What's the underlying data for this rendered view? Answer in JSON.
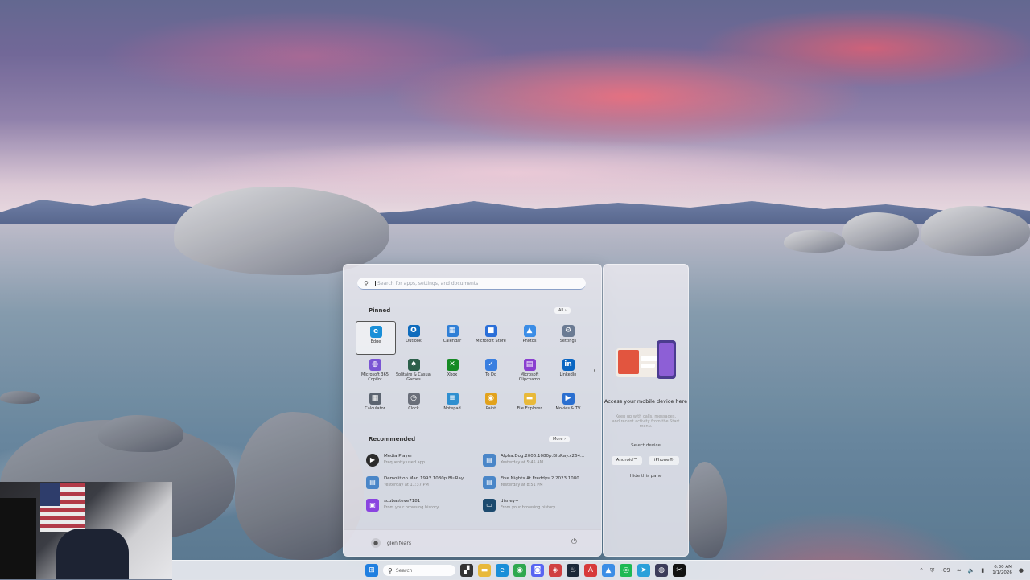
{
  "start_menu": {
    "search_placeholder": "Search for apps, settings, and documents",
    "pinned_title": "Pinned",
    "all_label": "All  ›",
    "pinned": [
      {
        "label": "Edge",
        "icon": "edge-icon",
        "color": "#1a8fd8",
        "glyph": "e"
      },
      {
        "label": "Outlook",
        "icon": "outlook-icon",
        "color": "#0f6cbd",
        "glyph": "O"
      },
      {
        "label": "Calendar",
        "icon": "calendar-icon",
        "color": "#2f7fd6",
        "glyph": "▦"
      },
      {
        "label": "Microsoft Store",
        "icon": "store-icon",
        "color": "#2b6fd8",
        "glyph": "■"
      },
      {
        "label": "Photos",
        "icon": "photos-icon",
        "color": "#3b8de6",
        "glyph": "▲"
      },
      {
        "label": "Settings",
        "icon": "gear-icon",
        "color": "#6b7b93",
        "glyph": "⚙"
      },
      {
        "label": "Microsoft 365 Copilot",
        "icon": "copilot-icon",
        "color": "#7a55d4",
        "glyph": "◍"
      },
      {
        "label": "Solitaire & Casual Games",
        "icon": "solitaire-icon",
        "color": "#2c5f4a",
        "glyph": "♠"
      },
      {
        "label": "Xbox",
        "icon": "xbox-icon",
        "color": "#168a24",
        "glyph": "✕"
      },
      {
        "label": "To Do",
        "icon": "todo-icon",
        "color": "#3a7fe0",
        "glyph": "✓"
      },
      {
        "label": "Microsoft Clipchamp",
        "icon": "clipchamp-icon",
        "color": "#8a3fd0",
        "glyph": "▤"
      },
      {
        "label": "LinkedIn",
        "icon": "linkedin-icon",
        "color": "#0a66c2",
        "glyph": "in"
      },
      {
        "label": "Calculator",
        "icon": "calculator-icon",
        "color": "#5c6470",
        "glyph": "▦"
      },
      {
        "label": "Clock",
        "icon": "clock-icon",
        "color": "#6a6f7a",
        "glyph": "◷"
      },
      {
        "label": "Notepad",
        "icon": "notepad-icon",
        "color": "#2e8fd0",
        "glyph": "≡"
      },
      {
        "label": "Paint",
        "icon": "paint-icon",
        "color": "#e2a21c",
        "glyph": "◉"
      },
      {
        "label": "File Explorer",
        "icon": "folder-icon",
        "color": "#e8b93a",
        "glyph": "▬"
      },
      {
        "label": "Movies & TV",
        "icon": "movies-icon",
        "color": "#2a6fd0",
        "glyph": "▶"
      }
    ],
    "recommended_title": "Recommended",
    "more_label": "More  ›",
    "recommended": [
      {
        "title": "Media Player",
        "sub": "Frequently used app",
        "icon": "media-player-icon",
        "color": "#2b2b2b",
        "glyph": "▶"
      },
      {
        "title": "Alpha.Dog.2006.1080p.BluRay.x264...",
        "sub": "Yesterday at 5:45 AM",
        "icon": "video-file-icon",
        "color": "#4a86c8",
        "glyph": "▤"
      },
      {
        "title": "Demolition.Man.1993.1080p.BluRay...",
        "sub": "Yesterday at 11:37 PM",
        "icon": "video-file-icon",
        "color": "#4a86c8",
        "glyph": "▤"
      },
      {
        "title": "Five.Nights.At.Freddys.2.2023.1080...",
        "sub": "Yesterday at 8:51 PM",
        "icon": "video-file-icon",
        "color": "#4a86c8",
        "glyph": "▤"
      },
      {
        "title": "scubasteve7181",
        "sub": "From your browsing history",
        "icon": "twitch-icon",
        "color": "#8a44e0",
        "glyph": "▣"
      },
      {
        "title": "disney+",
        "sub": "From your browsing history",
        "icon": "disney-thumb-icon",
        "color": "#1c4a6e",
        "glyph": "▭"
      }
    ],
    "user_name": "glen fears"
  },
  "side_panel": {
    "heading": "Access your mobile device here",
    "description": "Keep up with calls, messages, and recent activity from the Start menu.",
    "select_device": "Select device",
    "android_label": "Android™",
    "iphone_label": "iPhone®",
    "hide_label": "Hide this pane"
  },
  "taskbar": {
    "search_label": "Search",
    "apps": [
      {
        "icon": "windows-start-icon",
        "color": "#1f7fe0",
        "glyph": "⊞"
      },
      {
        "icon": "task-view-icon",
        "color": "#333333",
        "glyph": "▞"
      },
      {
        "icon": "file-explorer-icon",
        "color": "#e8b93a",
        "glyph": "▬"
      },
      {
        "icon": "edge-icon",
        "color": "#1a8fd8",
        "glyph": "e"
      },
      {
        "icon": "chrome-icon",
        "color": "#2fa84f",
        "glyph": "◉"
      },
      {
        "icon": "discord-icon",
        "color": "#5865f2",
        "glyph": "◙"
      },
      {
        "icon": "game-icon",
        "color": "#d04040",
        "glyph": "◈"
      },
      {
        "icon": "steam-icon",
        "color": "#1b2838",
        "glyph": "♨"
      },
      {
        "icon": "adobe-icon",
        "color": "#d73a3a",
        "glyph": "A"
      },
      {
        "icon": "photos-icon",
        "color": "#3b8de6",
        "glyph": "▲"
      },
      {
        "icon": "spotify-icon",
        "color": "#1db954",
        "glyph": "◎"
      },
      {
        "icon": "telegram-icon",
        "color": "#2aa0da",
        "glyph": "➤"
      },
      {
        "icon": "obs-icon",
        "color": "#3c3c5a",
        "glyph": "◍"
      },
      {
        "icon": "capcut-icon",
        "color": "#111111",
        "glyph": "✂"
      }
    ],
    "tray_temp": "-09",
    "time": "6:30 AM",
    "date": "1/1/2026"
  }
}
